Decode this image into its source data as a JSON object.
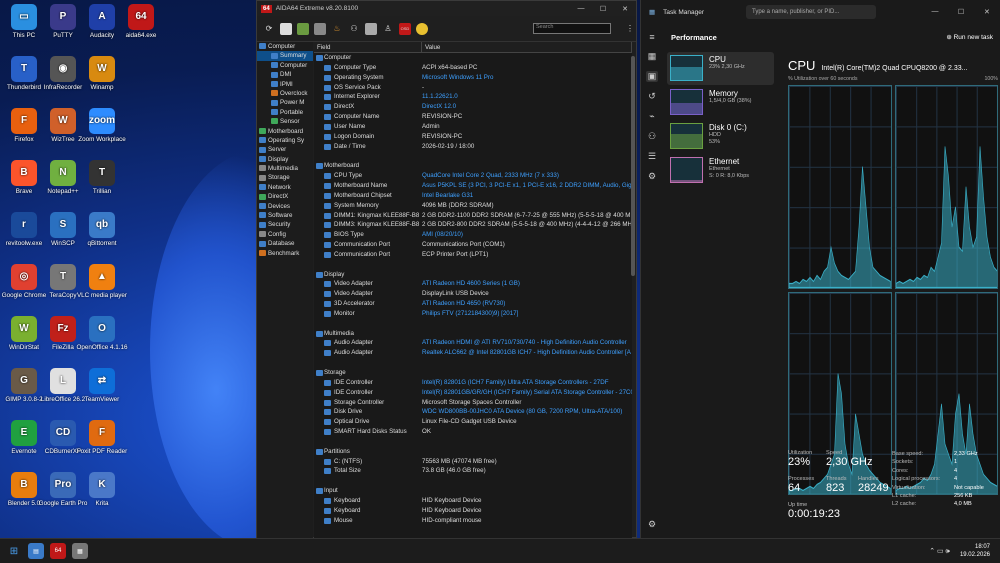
{
  "desktop": {
    "icons": [
      {
        "label": "This PC",
        "color": "#2a8fe0",
        "glyph": "▭"
      },
      {
        "label": "PuTTY",
        "color": "#3a3a8a",
        "glyph": "P"
      },
      {
        "label": "Audacity",
        "color": "#1f3fa8",
        "glyph": "A"
      },
      {
        "label": "aida64.exe",
        "color": "#c01818",
        "glyph": "64"
      },
      {
        "label": "Thunderbird",
        "color": "#2860c8",
        "glyph": "T"
      },
      {
        "label": "InfraRecorder",
        "color": "#555",
        "glyph": "◉"
      },
      {
        "label": "Winamp",
        "color": "#d88a10",
        "glyph": "W"
      },
      {
        "label": "Firefox",
        "color": "#e8600f",
        "glyph": "F"
      },
      {
        "label": "WizTree",
        "color": "#d0602a",
        "glyph": "W"
      },
      {
        "label": "Zoom Workplace",
        "color": "#2d8cff",
        "glyph": "zoom"
      },
      {
        "label": "Brave",
        "color": "#fb542b",
        "glyph": "B"
      },
      {
        "label": "Notepad++",
        "color": "#70b040",
        "glyph": "N"
      },
      {
        "label": "Trillian",
        "color": "#333",
        "glyph": "T"
      },
      {
        "label": "revitoolw.exe",
        "color": "#1a4a9a",
        "glyph": "r"
      },
      {
        "label": "WinSCP",
        "color": "#2a70c0",
        "glyph": "S"
      },
      {
        "label": "qBittorrent",
        "color": "#3a7ac8",
        "glyph": "qb"
      },
      {
        "label": "Google Chrome",
        "color": "#e04030",
        "glyph": "◎"
      },
      {
        "label": "TeraCopy",
        "color": "#777",
        "glyph": "T"
      },
      {
        "label": "VLC media player",
        "color": "#f08010",
        "glyph": "▲"
      },
      {
        "label": "WinDirStat",
        "color": "#7ab030",
        "glyph": "W"
      },
      {
        "label": "FileZilla",
        "color": "#c0201a",
        "glyph": "Fz"
      },
      {
        "label": "OpenOffice 4.1.16",
        "color": "#2a70c0",
        "glyph": "O"
      },
      {
        "label": "GIMP 3.0.8-2",
        "color": "#6a5a48",
        "glyph": "G"
      },
      {
        "label": "LibreOffice 26.2",
        "color": "#e0e0e0",
        "glyph": "L"
      },
      {
        "label": "TeamViewer",
        "color": "#0e6ed8",
        "glyph": "⇄"
      },
      {
        "label": "Evernote",
        "color": "#20a040",
        "glyph": "E"
      },
      {
        "label": "CDBurnerXP",
        "color": "#2a5ab0",
        "glyph": "CD"
      },
      {
        "label": "Foxit PDF Reader",
        "color": "#e06a10",
        "glyph": "F"
      },
      {
        "label": "Blender 5.0",
        "color": "#e87d0d",
        "glyph": "B"
      },
      {
        "label": "Google Earth Pro",
        "color": "#3a6ab8",
        "glyph": "Pro"
      },
      {
        "label": "Krita",
        "color": "#4a78c8",
        "glyph": "K"
      }
    ]
  },
  "aida": {
    "title": "AIDA64 Extreme v8.20.8100",
    "logo": "64",
    "search_placeholder": "Search",
    "tree": [
      {
        "label": "Computer",
        "sel": false,
        "color": "#3f7fc8"
      },
      {
        "label": "Summary",
        "sel": true,
        "color": "#3f7fc8"
      },
      {
        "label": "Computer",
        "sel": false,
        "color": "#3f7fc8"
      },
      {
        "label": "DMI",
        "sel": false,
        "color": "#3f7fc8"
      },
      {
        "label": "IPMI",
        "sel": false,
        "color": "#3f7fc8"
      },
      {
        "label": "Overclock",
        "sel": false,
        "color": "#d07020"
      },
      {
        "label": "Power M",
        "sel": false,
        "color": "#3f7fc8"
      },
      {
        "label": "Portable",
        "sel": false,
        "color": "#3f7fc8"
      },
      {
        "label": "Sensor",
        "sel": false,
        "color": "#3fa85a"
      },
      {
        "label": "Motherboard",
        "sel": false,
        "color": "#3fa85a"
      },
      {
        "label": "Operating Sy",
        "sel": false,
        "color": "#3f7fc8"
      },
      {
        "label": "Server",
        "sel": false,
        "color": "#3f7fc8"
      },
      {
        "label": "Display",
        "sel": false,
        "color": "#3f7fc8"
      },
      {
        "label": "Multimedia",
        "sel": false,
        "color": "#888"
      },
      {
        "label": "Storage",
        "sel": false,
        "color": "#888"
      },
      {
        "label": "Network",
        "sel": false,
        "color": "#3f7fc8"
      },
      {
        "label": "DirectX",
        "sel": false,
        "color": "#3fa85a"
      },
      {
        "label": "Devices",
        "sel": false,
        "color": "#3f7fc8"
      },
      {
        "label": "Software",
        "sel": false,
        "color": "#3f7fc8"
      },
      {
        "label": "Security",
        "sel": false,
        "color": "#3f7fc8"
      },
      {
        "label": "Config",
        "sel": false,
        "color": "#888"
      },
      {
        "label": "Database",
        "sel": false,
        "color": "#3f7fc8"
      },
      {
        "label": "Benchmark",
        "sel": false,
        "color": "#d07020"
      }
    ],
    "col_field": "Field",
    "col_value": "Value",
    "rows": [
      {
        "s": 1,
        "f": "Computer",
        "v": ""
      },
      {
        "f": "Computer Type",
        "v": "ACPI x64-based PC"
      },
      {
        "f": "Operating System",
        "v": "Microsoft Windows 11 Pro",
        "l": 1
      },
      {
        "f": "OS Service Pack",
        "v": "-"
      },
      {
        "f": "Internet Explorer",
        "v": "11.1.22621.0",
        "l": 1
      },
      {
        "f": "DirectX",
        "v": "DirectX 12.0",
        "l": 1
      },
      {
        "f": "Computer Name",
        "v": "REVISION-PC"
      },
      {
        "f": "User Name",
        "v": "Admin"
      },
      {
        "f": "Logon Domain",
        "v": "REVISION-PC"
      },
      {
        "f": "Date / Time",
        "v": "2026-02-19 / 18:00"
      },
      {
        "f": "",
        "v": ""
      },
      {
        "s": 1,
        "f": "Motherboard",
        "v": ""
      },
      {
        "f": "CPU Type",
        "v": "QuadCore Intel Core 2 Quad, 2333 MHz (7 x 333)",
        "l": 1
      },
      {
        "f": "Motherboard Name",
        "v": "Asus P5KPL SE  (3 PCI, 3 PCI-E x1, 1 PCI-E x16, 2 DDR2 DIMM, Audio, Gigabi",
        "l": 1
      },
      {
        "f": "Motherboard Chipset",
        "v": "Intel Bearlake G31",
        "l": 1
      },
      {
        "f": "System Memory",
        "v": "4096 MB  (DDR2 SDRAM)"
      },
      {
        "f": "DIMM1: Kingmax KLEE88F-B8",
        "v": "2 GB DDR2-1100 DDR2 SDRAM  (6-7-7-25 @ 555 MHz)  (5-5-5-18 @ 400 MH"
      },
      {
        "f": "DIMM3: Kingmax KLEE88F-B8",
        "v": "2 GB DDR2-800 DDR2 SDRAM  (5-5-5-18 @ 400 MHz)  (4-4-4-12 @ 266 MHz"
      },
      {
        "f": "BIOS Type",
        "v": "AMI (08/20/10)",
        "l": 1
      },
      {
        "f": "Communication Port",
        "v": "Communications Port (COM1)"
      },
      {
        "f": "Communication Port",
        "v": "ECP Printer Port (LPT1)"
      },
      {
        "f": "",
        "v": ""
      },
      {
        "s": 1,
        "f": "Display",
        "v": ""
      },
      {
        "f": "Video Adapter",
        "v": "ATI Radeon HD 4600 Series  (1 GB)",
        "l": 1
      },
      {
        "f": "Video Adapter",
        "v": "DisplayLink USB Device"
      },
      {
        "f": "3D Accelerator",
        "v": "ATI Radeon HD 4650 (RV730)",
        "l": 1
      },
      {
        "f": "Monitor",
        "v": "Philips FTV  (2712184300)9)  [2017]",
        "l": 1
      },
      {
        "f": "",
        "v": ""
      },
      {
        "s": 1,
        "f": "Multimedia",
        "v": ""
      },
      {
        "f": "Audio Adapter",
        "v": "ATI Radeon HDMI @ ATI RV710/730/740 - High Definition Audio Controller",
        "l": 1
      },
      {
        "f": "Audio Adapter",
        "v": "Realtek ALC662 @ Intel 82801GB ICH7 - High Definition Audio Controller [A",
        "l": 1
      },
      {
        "f": "",
        "v": ""
      },
      {
        "s": 1,
        "f": "Storage",
        "v": ""
      },
      {
        "f": "IDE Controller",
        "v": "Intel(R) 82801G (ICH7 Family) Ultra ATA Storage Controllers - 27DF",
        "l": 1
      },
      {
        "f": "IDE Controller",
        "v": "Intel(R) 82801GB/GR/GH (ICH7 Family) Serial ATA Storage Controller - 27C0",
        "l": 1
      },
      {
        "f": "Storage Controller",
        "v": "Microsoft Storage Spaces Controller"
      },
      {
        "f": "Disk Drive",
        "v": "WDC WD800BB-00JHC0 ATA Device  (80 GB, 7200 RPM, Ultra-ATA/100)",
        "l": 1
      },
      {
        "f": "Optical Drive",
        "v": "Linux File-CD Gadget USB Device"
      },
      {
        "f": "SMART Hard Disks Status",
        "v": "OK"
      },
      {
        "f": "",
        "v": ""
      },
      {
        "s": 1,
        "f": "Partitions",
        "v": ""
      },
      {
        "f": "C: (NTFS)",
        "v": "75563 MB (47074 MB free)"
      },
      {
        "f": "Total Size",
        "v": "73.8 GB (46.0 GB free)"
      },
      {
        "f": "",
        "v": ""
      },
      {
        "s": 1,
        "f": "Input",
        "v": ""
      },
      {
        "f": "Keyboard",
        "v": "HID Keyboard Device"
      },
      {
        "f": "Keyboard",
        "v": "HID Keyboard Device"
      },
      {
        "f": "Mouse",
        "v": "HID-compliant mouse"
      }
    ]
  },
  "taskmgr": {
    "title": "Task Manager",
    "search_placeholder": "Type a name, publisher, or PID...",
    "section": "Performance",
    "run_task": "Run new task",
    "items": [
      {
        "name": "CPU",
        "sub1": "23% 2,30 GHz",
        "sub2": "",
        "sel": true
      },
      {
        "name": "Memory",
        "sub1": "1,5/4,0 GB (38%)",
        "sub2": "",
        "sel": false
      },
      {
        "name": "Disk 0 (C:)",
        "sub1": "HDD",
        "sub2": "53%",
        "sel": false
      },
      {
        "name": "Ethernet",
        "sub1": "Ethernet",
        "sub2": "S: 0  R: 8,0 Kbps",
        "sel": false
      }
    ],
    "cpu_title": "CPU",
    "cpu_name": "Intel(R) Core(TM)2 Quad CPUQ8200 @ 2.33...",
    "util_label": "% Utilization over 60 seconds",
    "util_max": "100%",
    "stats": {
      "utilization_label": "Utilization",
      "utilization": "23%",
      "speed_label": "Speed",
      "speed": "2,30 GHz",
      "processes_label": "Processes",
      "processes": "64",
      "threads_label": "Threads",
      "threads": "823",
      "handles_label": "Handles",
      "handles": "28249",
      "uptime_label": "Up time",
      "uptime": "0:00:19:23"
    },
    "specs": [
      {
        "k": "Base speed:",
        "v": "2,33 GHz"
      },
      {
        "k": "Sockets:",
        "v": "1"
      },
      {
        "k": "Cores:",
        "v": "4"
      },
      {
        "k": "Logical processors:",
        "v": "4"
      },
      {
        "k": "Virtualization:",
        "v": "Not capable"
      },
      {
        "k": "L1 cache:",
        "v": "256 KB"
      },
      {
        "k": "L2 cache:",
        "v": "4,0 MB"
      }
    ],
    "graph_color": "#3ab0c8"
  },
  "taskbar": {
    "time": "18:07",
    "date": "19.02.2026"
  }
}
